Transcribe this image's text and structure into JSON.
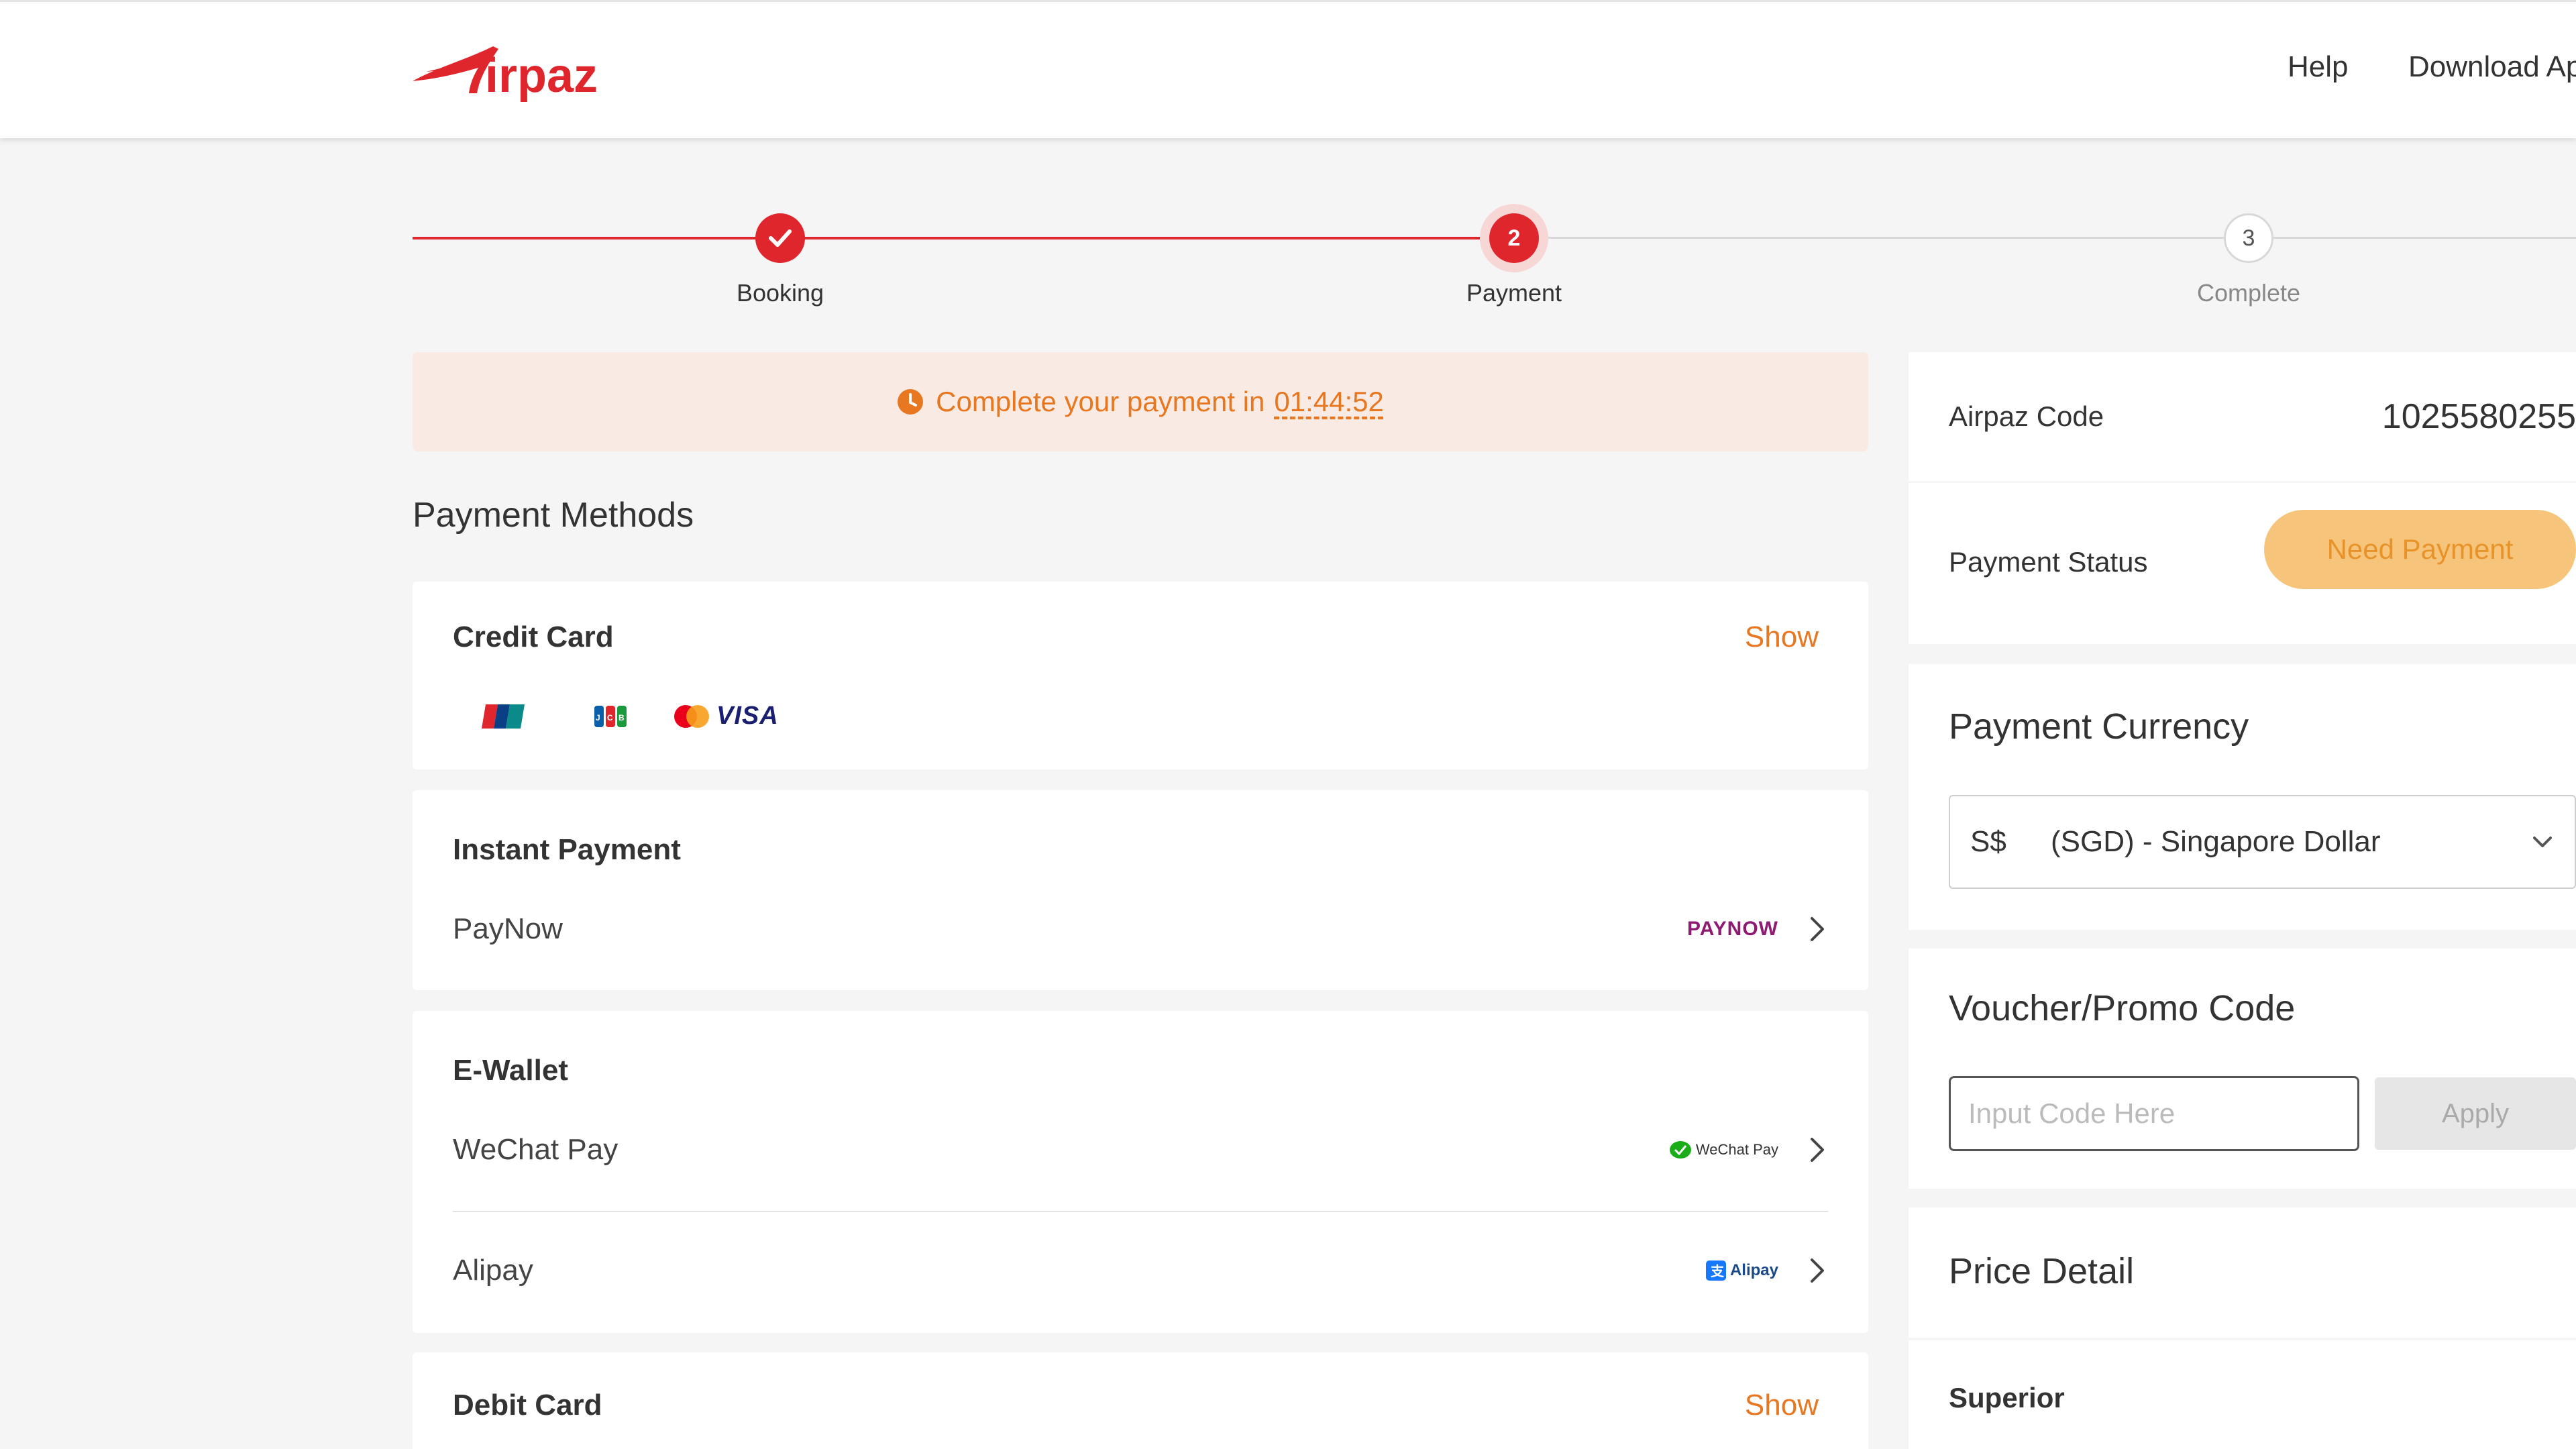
{
  "header": {
    "logo_text": "Airpaz",
    "nav": {
      "help": "Help",
      "download": "Download Ap"
    }
  },
  "stepper": {
    "steps": [
      {
        "label": "Booking",
        "state": "done",
        "number": ""
      },
      {
        "label": "Payment",
        "state": "active",
        "number": "2"
      },
      {
        "label": "Complete",
        "state": "todo",
        "number": "3"
      }
    ]
  },
  "timer": {
    "text": "Complete your payment in",
    "time": "01:44:52"
  },
  "payment_methods": {
    "title": "Payment Methods",
    "credit_card": {
      "title": "Credit Card",
      "show": "Show",
      "logos": [
        "unionpay-logo",
        "jcb-logo",
        "mastercard-logo",
        "visa-logo"
      ],
      "visa_text": "VISA"
    },
    "instant_payment": {
      "title": "Instant Payment",
      "items": [
        {
          "name": "PayNow",
          "logo_text": "PAYNOW"
        }
      ]
    },
    "ewallet": {
      "title": "E-Wallet",
      "items": [
        {
          "name": "WeChat Pay",
          "logo_text": "WeChat Pay"
        },
        {
          "name": "Alipay",
          "logo_text": "Alipay"
        }
      ]
    },
    "debit_card": {
      "title": "Debit Card",
      "show": "Show"
    }
  },
  "summary": {
    "airpaz_code_label": "Airpaz Code",
    "airpaz_code": "1025580255",
    "payment_status_label": "Payment Status",
    "payment_status": "Need Payment"
  },
  "currency": {
    "title": "Payment Currency",
    "symbol": "S$",
    "selected": "(SGD) - Singapore Dollar"
  },
  "voucher": {
    "title": "Voucher/Promo Code",
    "placeholder": "Input Code Here",
    "value": "",
    "apply_label": "Apply"
  },
  "price_detail": {
    "title": "Price Detail",
    "item": "Superior"
  },
  "colors": {
    "brand_red": "#e0262d",
    "accent_orange": "#e87722",
    "status_pill": "#f6c57b",
    "timer_bg": "#f9ebe3"
  }
}
